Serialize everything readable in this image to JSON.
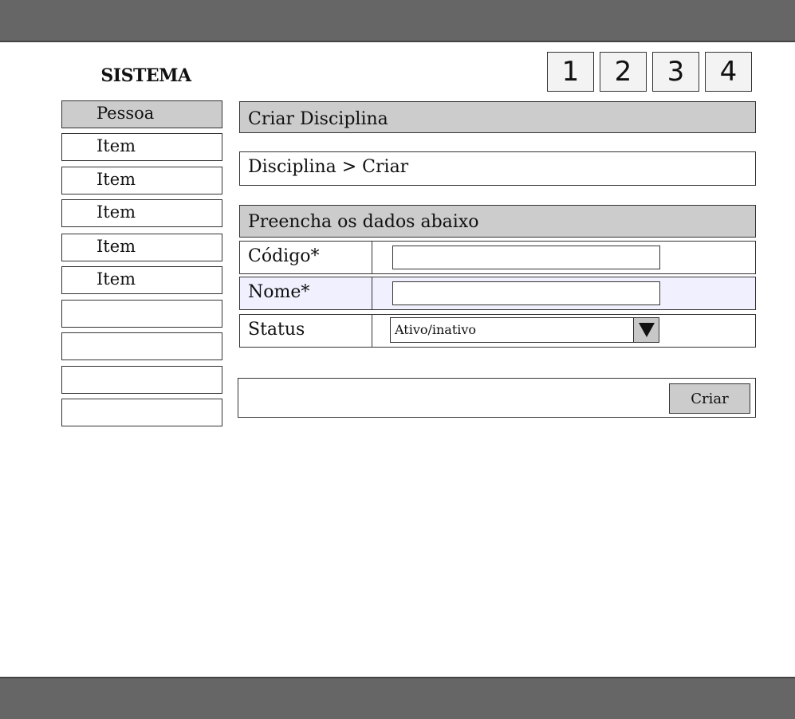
{
  "app": {
    "title": "SISTEMA"
  },
  "pagination": [
    "1",
    "2",
    "3",
    "4"
  ],
  "sidebar": {
    "items": [
      {
        "label": "Pessoa",
        "active": true
      },
      {
        "label": "Item"
      },
      {
        "label": "Item"
      },
      {
        "label": "Item"
      },
      {
        "label": "Item"
      },
      {
        "label": "Item"
      },
      {
        "label": ""
      },
      {
        "label": ""
      },
      {
        "label": ""
      },
      {
        "label": ""
      }
    ]
  },
  "main": {
    "header": "Criar Disciplina",
    "breadcrumb": "Disciplina > Criar",
    "form_header": "Preencha os dados abaixo",
    "fields": {
      "codigo": {
        "label": "Código*",
        "value": ""
      },
      "nome": {
        "label": "Nome*",
        "value": ""
      },
      "status": {
        "label": "Status",
        "value": "Ativo/inativo"
      }
    },
    "submit_label": "Criar"
  },
  "colors": {
    "top_bar": "#666666",
    "header_fill": "#cccccc",
    "highlight_row": "#f1f0ff"
  }
}
